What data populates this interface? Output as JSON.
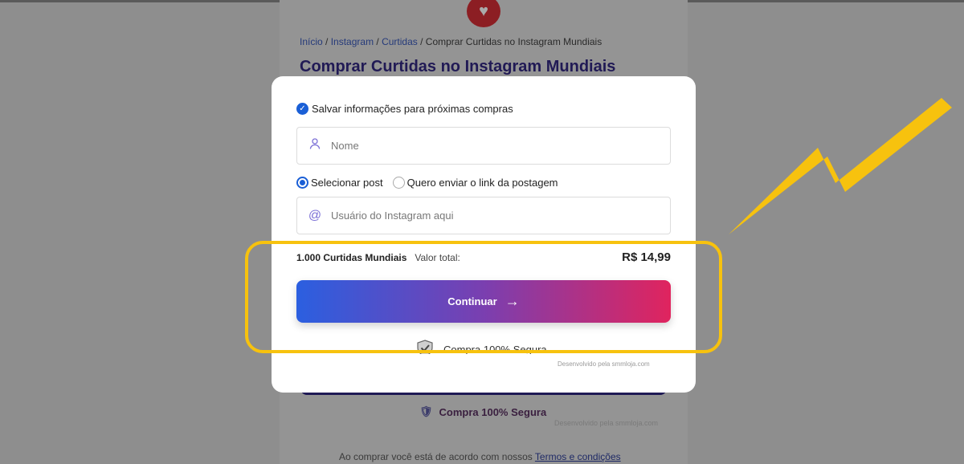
{
  "background_page": {
    "breadcrumb": {
      "home": "Início",
      "sep1": " / ",
      "instagram": "Instagram",
      "sep2": " / ",
      "curtidas": "Curtidas",
      "sep3": " / ",
      "current": "Comprar Curtidas no Instagram Mundiais"
    },
    "title": "Comprar Curtidas no Instagram Mundiais",
    "secure_text": "Compra 100% Segura",
    "dev_credit": "Desenvolvido pela smmloja.com",
    "terms_prefix": "Ao comprar você está de acordo com nossos ",
    "terms_link": "Termos e condições"
  },
  "modal": {
    "save_info_label": "Salvar informações para próximas compras",
    "name_placeholder": "Nome",
    "radio_options": [
      "Selecionar post",
      "Quero enviar o link da postagem"
    ],
    "username_placeholder": "Usuário do Instagram aqui",
    "product": "1.000 Curtidas Mundiais",
    "total_label": "Valor total:",
    "price": "R$ 14,99",
    "continue_label": "Continuar",
    "secure_text": "Compra 100% Segura",
    "dev_credit": "Desenvolvido pela smmloja.com"
  },
  "colors": {
    "brand_blue": "#1a5fd6",
    "gradient_start": "#2b5fe0",
    "gradient_end": "#e0245e",
    "annotation_yellow": "#f7c20e"
  },
  "icons": {
    "logo": "heart-icon",
    "name_field": "user-icon",
    "username_field": "at-icon",
    "continue": "arrow-right-icon",
    "secure": "shield-check-icon"
  }
}
